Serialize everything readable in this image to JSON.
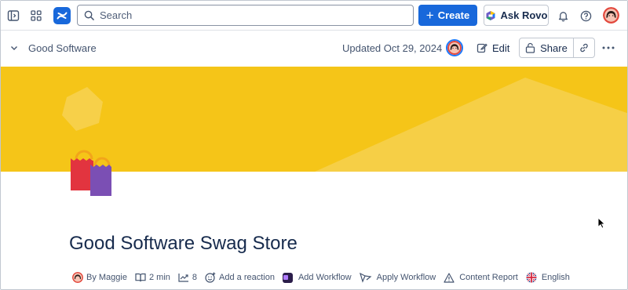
{
  "topnav": {
    "search_placeholder": "Search",
    "create_label": "Create",
    "ask_rovo_label": "Ask Rovo"
  },
  "page_header": {
    "breadcrumb": "Good Software",
    "updated": "Updated Oct 29, 2024",
    "edit_label": "Edit",
    "share_label": "Share"
  },
  "page": {
    "title": "Good Software Swag Store",
    "byline": {
      "author": "By Maggie",
      "read_time": "2 min",
      "views": "8",
      "add_reaction": "Add a reaction",
      "add_workflow": "Add Workflow",
      "apply_workflow": "Apply Workflow",
      "content_report": "Content Report",
      "language": "English"
    }
  },
  "colors": {
    "brand": "#1868db",
    "banner": "#f5c518",
    "text": "#172b4d"
  },
  "icons": [
    "sidebar-toggle-icon",
    "app-switcher-icon",
    "confluence-logo-icon",
    "search-icon",
    "plus-icon",
    "rovo-icon",
    "bell-icon",
    "help-icon",
    "chevron-down-icon",
    "pencil-icon",
    "lock-icon",
    "link-icon",
    "more-icon",
    "book-icon",
    "trend-icon",
    "emoji-icon",
    "workflow-icon",
    "apply-workflow-icon",
    "warning-icon",
    "uk-flag-icon",
    "cursor-icon"
  ]
}
